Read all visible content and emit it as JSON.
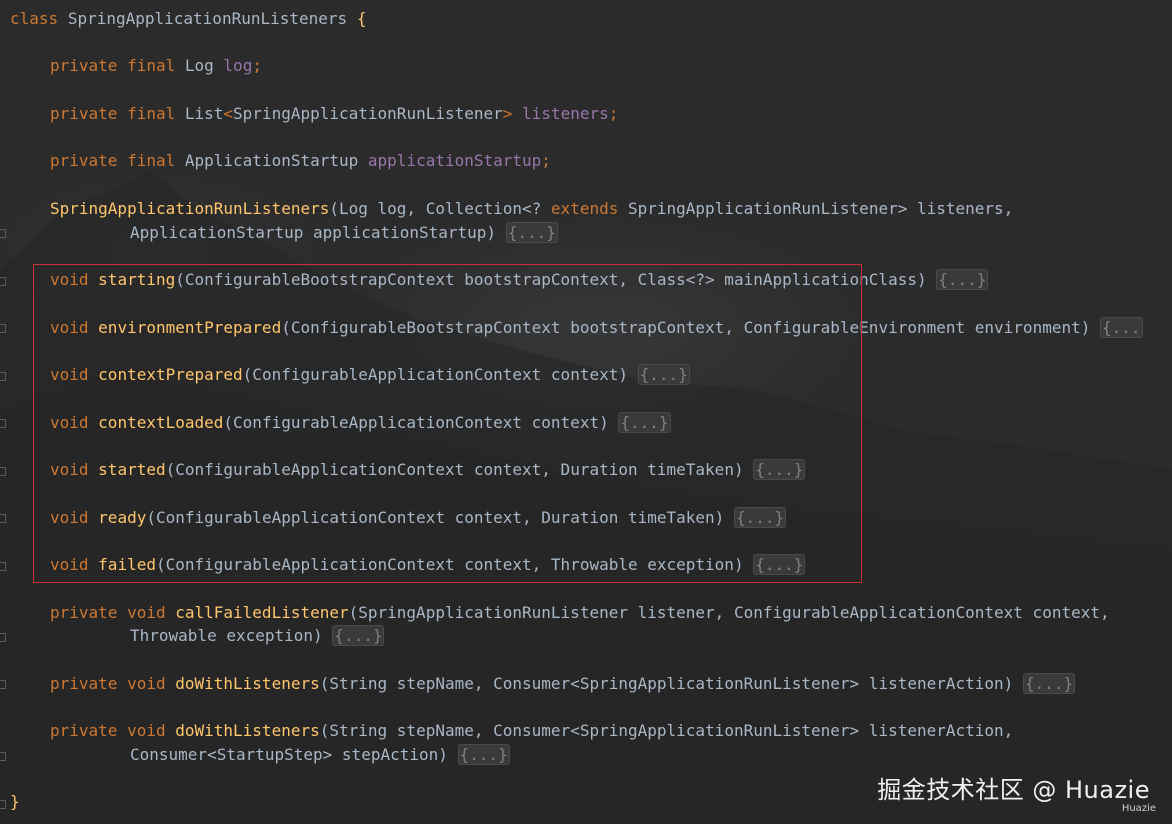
{
  "colors": {
    "background": "#2b2b2b",
    "keyword": "#cc7832",
    "field": "#9876aa",
    "method": "#ffc66d",
    "text": "#a9b7c6",
    "folded": "#808080",
    "highlight_border": "#c9303a"
  },
  "code": {
    "class_decl": {
      "kw": "class",
      "name": "SpringApplicationRunListeners",
      "brace": "{"
    },
    "field_log": {
      "mods": "private final",
      "type": "Log",
      "name": "log",
      "semi": ";"
    },
    "field_listeners": {
      "mods": "private final",
      "type": "List",
      "lt": "<",
      "generic": "SpringApplicationRunListener",
      "gt": ">",
      "name": "listeners",
      "semi": ";"
    },
    "field_startup": {
      "mods": "private final",
      "type": "ApplicationStartup",
      "name": "applicationStartup",
      "semi": ";"
    },
    "ctor": {
      "name": "SpringApplicationRunListeners",
      "line1_params": "(Log log, Collection<? ",
      "extends_kw": "extends",
      "line1_rest": " SpringApplicationRunListener> listeners,",
      "line2_params": "ApplicationStartup applicationStartup)",
      "body": "{...}"
    },
    "m_starting": {
      "ret": "void",
      "name": "starting",
      "params": "(ConfigurableBootstrapContext bootstrapContext, Class<?> mainApplicationClass)",
      "body": "{...}"
    },
    "m_env": {
      "ret": "void",
      "name": "environmentPrepared",
      "params": "(ConfigurableBootstrapContext bootstrapContext, ConfigurableEnvironment environment)",
      "body": "{..."
    },
    "m_ctxPrepared": {
      "ret": "void",
      "name": "contextPrepared",
      "params": "(ConfigurableApplicationContext context)",
      "body": "{...}"
    },
    "m_ctxLoaded": {
      "ret": "void",
      "name": "contextLoaded",
      "params": "(ConfigurableApplicationContext context)",
      "body": "{...}"
    },
    "m_started": {
      "ret": "void",
      "name": "started",
      "params": "(ConfigurableApplicationContext context, Duration timeTaken)",
      "body": "{...}"
    },
    "m_ready": {
      "ret": "void",
      "name": "ready",
      "params": "(ConfigurableApplicationContext context, Duration timeTaken)",
      "body": "{...}"
    },
    "m_failed": {
      "ret": "void",
      "name": "failed",
      "params": "(ConfigurableApplicationContext context, Throwable exception)",
      "body": "{...}"
    },
    "m_callFailed": {
      "mods": "private void",
      "name": "callFailedListener",
      "line1_params": "(SpringApplicationRunListener listener, ConfigurableApplicationContext context,",
      "line2_params": "Throwable exception)",
      "body": "{...}"
    },
    "m_doWith1": {
      "mods": "private void",
      "name": "doWithListeners",
      "params": "(String stepName, Consumer<SpringApplicationRunListener> listenerAction)",
      "body": "{...}"
    },
    "m_doWith2": {
      "mods": "private void",
      "name": "doWithListeners",
      "line1_params": "(String stepName, Consumer<SpringApplicationRunListener> listenerAction,",
      "line2_params": "Consumer<StartupStep> stepAction)",
      "body": "{...}"
    },
    "class_close": "}"
  },
  "watermark": {
    "main": "掘金技术社区 @ Huazie",
    "sub": "Huazie"
  }
}
